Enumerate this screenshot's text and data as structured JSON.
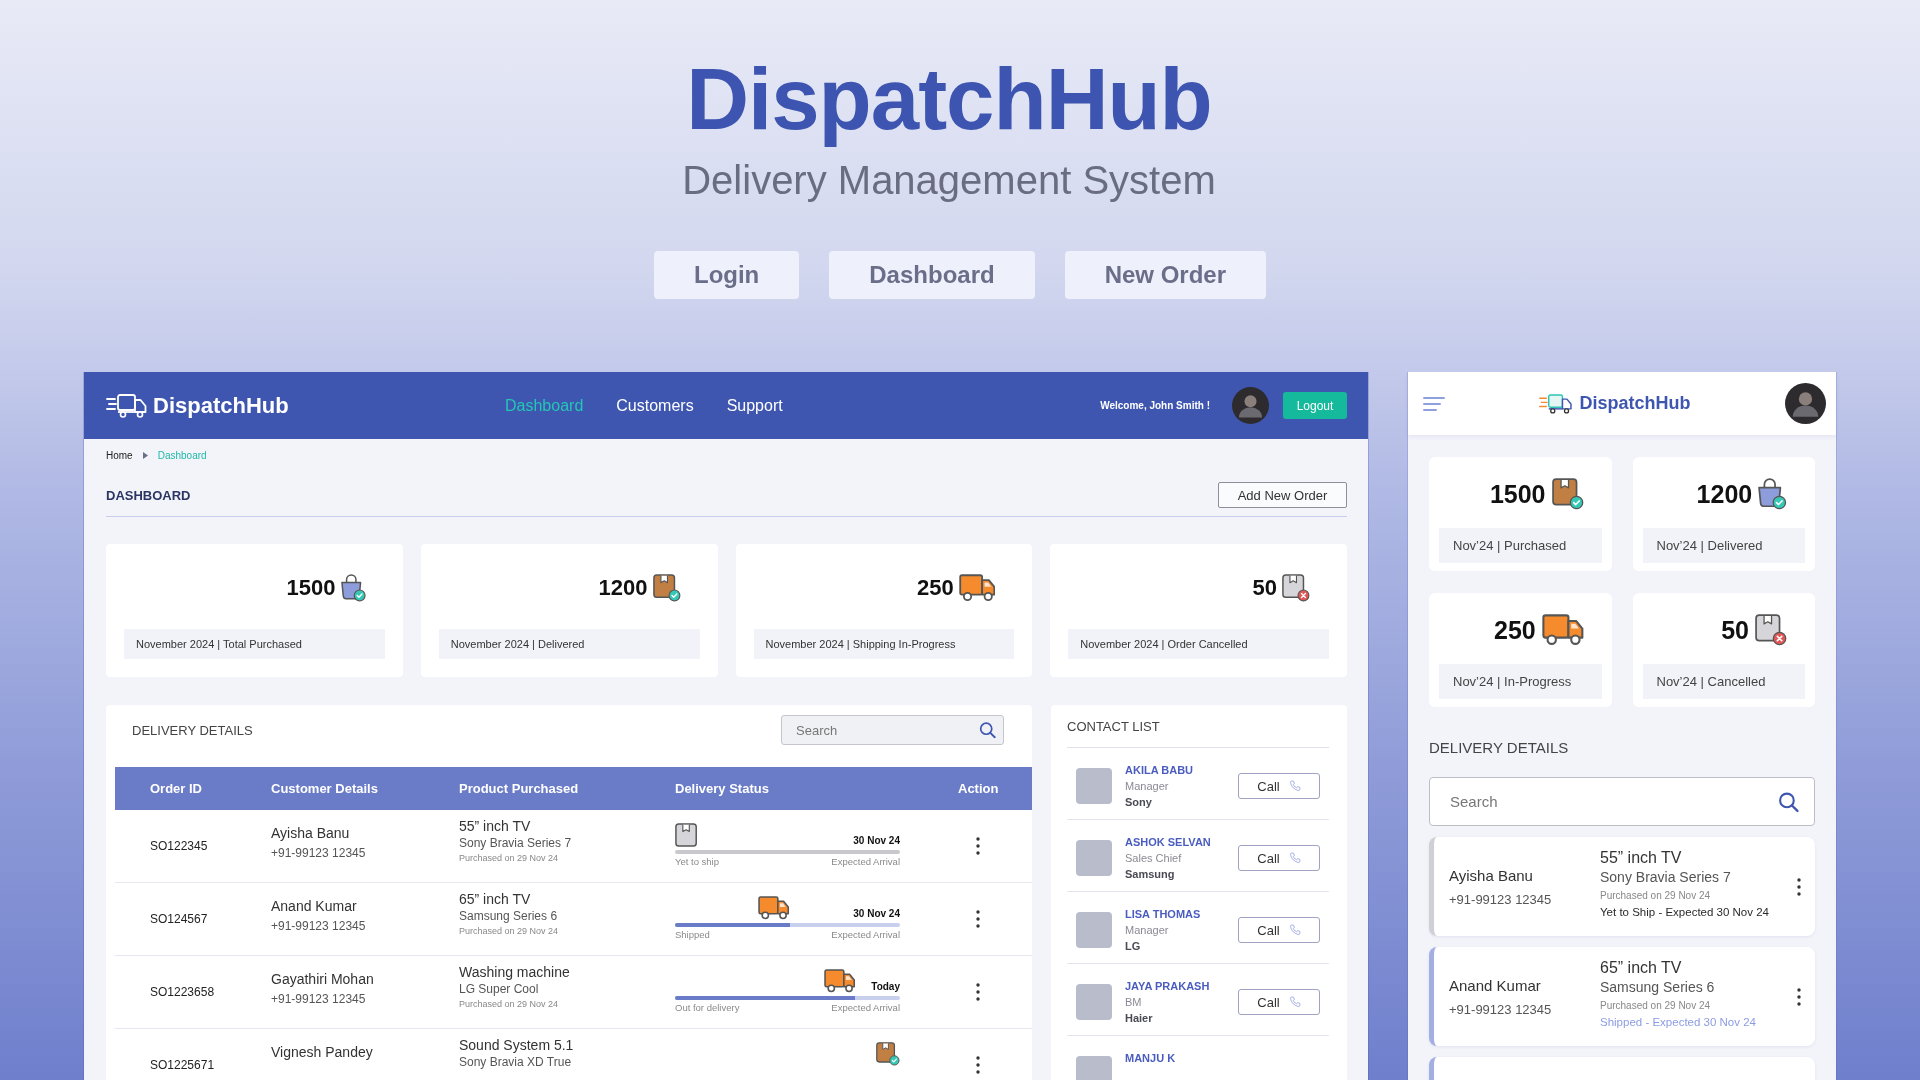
{
  "hero": {
    "title": "DispatchHub",
    "subtitle": "Delivery Management System",
    "buttons": [
      "Login",
      "Dashboard",
      "New Order"
    ]
  },
  "desktop": {
    "navbar": {
      "brand": "DispatchHub",
      "links": [
        {
          "label": "Dashboard",
          "selected": true
        },
        {
          "label": "Customers",
          "selected": false
        },
        {
          "label": "Support",
          "selected": false
        }
      ],
      "welcome": "Welcome, John Smith !",
      "logout": "Logout"
    },
    "breadcrumb": [
      {
        "label": "Home",
        "selected": false
      },
      {
        "label": "Dashboard",
        "selected": true
      }
    ],
    "page_title": "DASHBOARD",
    "add_button": "Add New Order",
    "stats": [
      {
        "kind": "bag",
        "value": "1500",
        "label": "November 2024 | Total Purchased"
      },
      {
        "kind": "box",
        "value": "1200",
        "label": "November 2024 | Delivered"
      },
      {
        "kind": "truck",
        "value": "250",
        "label": "November 2024 | Shipping In-Progress"
      },
      {
        "kind": "cancelled",
        "value": "50",
        "label": "November 2024 | Order Cancelled"
      }
    ],
    "delivery": {
      "title": "DELIVERY DETAILS",
      "search": {
        "placeholder": "Search"
      },
      "columns": [
        "Order ID",
        "Customer Details",
        "Product Purchased",
        "Delivery Status",
        "Action"
      ],
      "rows": [
        {
          "order_id": "SO122345",
          "customer": "Ayisha Banu",
          "phone": "+91-99123 12345",
          "product": "55” inch TV",
          "model": "Sony Bravia Series 7",
          "purchased": "Purchased on 29 Nov 24",
          "status": {
            "kind": "pending",
            "date": "30 Nov 24",
            "label": "Yet to ship",
            "arrival": "Expected Arrival"
          }
        },
        {
          "order_id": "SO124567",
          "customer": "Anand Kumar",
          "phone": "+91-99123 12345",
          "product": "65” inch TV",
          "model": "Samsung Series 6",
          "purchased": "Purchased on 29 Nov 24",
          "status": {
            "kind": "transit",
            "level": 0.51,
            "date": "30 Nov 24",
            "label": "Shipped",
            "arrival": "Expected Arrival"
          }
        },
        {
          "order_id": "SO1223658",
          "customer": "Gayathiri Mohan",
          "phone": "+91-99123 12345",
          "product": "Washing machine",
          "model": "LG Super Cool",
          "purchased": "Purchased on 29 Nov 24",
          "status": {
            "kind": "transit",
            "level": 0.8,
            "date": "Today",
            "label": "Out for delivery",
            "arrival": "Expected Arrival"
          }
        },
        {
          "order_id": "SO1225671",
          "customer": "Vignesh Pandey",
          "product": "Sound System 5.1",
          "model": "Sony Bravia XD True",
          "status": {
            "kind": "delivered"
          }
        }
      ]
    },
    "contacts": {
      "title": "CONTACT LIST",
      "items": [
        {
          "name": "AKILA BABU",
          "role": "Manager",
          "company": "Sony",
          "call": "Call"
        },
        {
          "name": "ASHOK SELVAN",
          "role": "Sales Chief",
          "company": "Samsung",
          "call": "Call"
        },
        {
          "name": "LISA THOMAS",
          "role": "Manager",
          "company": "LG",
          "call": "Call"
        },
        {
          "name": "JAYA PRAKASH",
          "role": "BM",
          "company": "Haier",
          "call": "Call"
        },
        {
          "name": "MANJU K"
        }
      ]
    }
  },
  "mobile": {
    "brand": "DispatchHub",
    "stats": [
      {
        "kind": "box",
        "value": "1500",
        "label": "Nov’24 | Purchased"
      },
      {
        "kind": "bag",
        "value": "1200",
        "label": "Nov’24 | Delivered"
      },
      {
        "kind": "truck",
        "value": "250",
        "label": "Nov’24 | In-Progress"
      },
      {
        "kind": "cancelled",
        "value": "50",
        "label": "Nov’24 | Cancelled"
      }
    ],
    "delivery_title": "DELIVERY DETAILS",
    "search": {
      "placeholder": "Search"
    },
    "orders": [
      {
        "kind": "pending",
        "customer": "Ayisha Banu",
        "phone": "+91-99123 12345",
        "product": "55” inch TV",
        "model": "Sony Bravia Series 7",
        "purchased": "Purchased on 29 Nov 24",
        "status": "Yet to Ship - Expected 30 Nov 24"
      },
      {
        "kind": "shipped",
        "customer": "Anand Kumar",
        "phone": "+91-99123 12345",
        "product": "65” inch TV",
        "model": "Samsung Series 6",
        "purchased": "Purchased on 29 Nov 24",
        "status": "Shipped - Expected 30 Nov 24"
      },
      {
        "kind": "shipped"
      }
    ]
  }
}
